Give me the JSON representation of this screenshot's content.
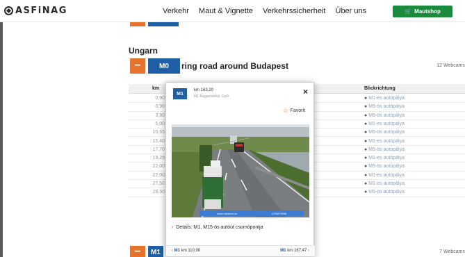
{
  "header": {
    "logo_text": "ASFiNAG",
    "nav": [
      "Verkehr",
      "Maut & Vignette",
      "Verkehrssicherheit",
      "Über uns"
    ],
    "shop_label": "Mautshop",
    "shop_color": "#1a8a3c"
  },
  "section": {
    "country": "Ungarn",
    "road": "M0",
    "road_description": "ring road around Budapest",
    "webcam_count": "12 Webcams",
    "minus": "−"
  },
  "table": {
    "col_km": "km",
    "col_direction": "Blickrichtung",
    "rows": [
      {
        "km": "0,90",
        "direction": "M1-es autópálya"
      },
      {
        "km": "0,90",
        "direction": "M5-ös autópálya"
      },
      {
        "km": "3,80",
        "direction": "M5-ös autópálya"
      },
      {
        "km": "5,00",
        "direction": "M1-es autópálya"
      },
      {
        "km": "10,65",
        "direction": "M5-ös autópálya"
      },
      {
        "km": "15,40",
        "direction": "M1-es autópálya"
      },
      {
        "km": "17,70",
        "direction": "M5-ös autópálya"
      },
      {
        "km": "19,29",
        "direction": "M1-es autópálya"
      },
      {
        "km": "22,00",
        "direction": "M5-ös autópálya"
      },
      {
        "km": "22,00",
        "direction": "M1-es autópálya"
      },
      {
        "km": "27,50",
        "direction": "M1-es autópálya"
      },
      {
        "km": "28,50",
        "direction": "M5-ös autópálya"
      }
    ]
  },
  "bottom_row": {
    "road": "M1",
    "webcam_count": "7 Webcams"
  },
  "popup": {
    "road": "M1",
    "km": "km 163,20",
    "location": "M1-Nagyendrédi, Győr",
    "favorite": "Favorit",
    "cam_caption_left": "www.utinform.hu",
    "cam_caption_right": "UTINFORM",
    "details": "Details: M1, M15-ös autóút csomópontja",
    "prev_road": "M1",
    "prev_km": "km 110,00",
    "next_road": "M1",
    "next_km": "km 167,47"
  },
  "colors": {
    "orange": "#e8722a",
    "blue": "#1f5fa6"
  }
}
